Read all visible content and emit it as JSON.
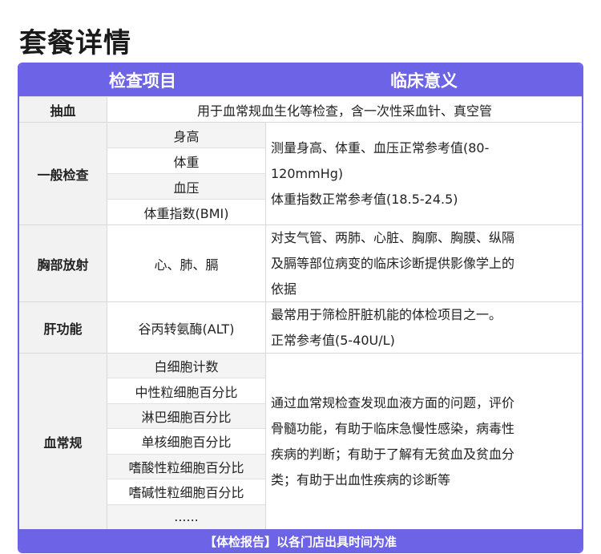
{
  "title": "套餐详情",
  "header": {
    "item": "检查项目",
    "meaning": "临床意义"
  },
  "rows": [
    {
      "name": "抽血",
      "detail": "用于血常规血生化等检查，含一次性采血针、真空管"
    },
    {
      "name": "一般检查",
      "items": [
        "身高",
        "体重",
        "血压",
        "体重指数(BMI)"
      ],
      "meaning": [
        "测量身高、体重、血压正常参考值(80-",
        "120mmHg)",
        "体重指数正常参考值(18.5-24.5)"
      ]
    },
    {
      "name": "胸部放射",
      "items": [
        "心、肺、膈"
      ],
      "meaning": [
        "对支气管、两肺、心脏、胸廓、胸膜、纵隔",
        "及膈等部位病变的临床诊断提供影像学上的",
        "依据"
      ]
    },
    {
      "name": "肝功能",
      "items": [
        "谷丙转氨酶(ALT)"
      ],
      "meaning": [
        "最常用于筛检肝脏机能的体检项目之一。",
        "正常参考值(5-40U/L)"
      ]
    },
    {
      "name": "血常规",
      "items": [
        "白细胞计数",
        "中性粒细胞百分比",
        "淋巴细胞百分比",
        "单核细胞百分比",
        "嗜酸性粒细胞百分比",
        "嗜碱性粒细胞百分比",
        "......"
      ],
      "meaning": [
        "通过血常规检查发现血液方面的问题，评价",
        "骨髓功能，有助于临床急慢性感染，病毒性",
        "疾病的判断；有助于了解有无贫血及贫血分",
        "类；有助于出血性疾病的诊断等"
      ]
    }
  ],
  "footer": "【体检报告】以各门店出具时间为准",
  "colors": {
    "accent": "#6c63e6",
    "row_bg": "#f2f2f2"
  }
}
